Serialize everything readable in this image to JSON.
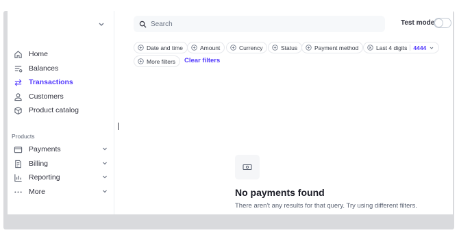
{
  "sidebar": {
    "nav": [
      {
        "label": "Home",
        "icon": "home-icon"
      },
      {
        "label": "Balances",
        "icon": "balances-icon"
      },
      {
        "label": "Transactions",
        "icon": "transactions-icon",
        "active": true
      },
      {
        "label": "Customers",
        "icon": "customer-icon"
      },
      {
        "label": "Product catalog",
        "icon": "product-icon"
      }
    ],
    "section_label": "Products",
    "products": [
      {
        "label": "Payments",
        "icon": "payments-icon"
      },
      {
        "label": "Billing",
        "icon": "billing-icon"
      },
      {
        "label": "Reporting",
        "icon": "reporting-icon"
      },
      {
        "label": "More",
        "icon": "more-icon"
      }
    ]
  },
  "header": {
    "search_placeholder": "Search",
    "test_mode_label": "Test mode",
    "test_mode_on": false
  },
  "filters": {
    "chips": [
      "Date and time",
      "Amount",
      "Currency",
      "Status",
      "Payment method"
    ],
    "last4": {
      "label": "Last 4 digits",
      "value": "4444"
    },
    "more_filters": "More filters",
    "clear": "Clear filters"
  },
  "empty_state": {
    "title": "No payments found",
    "subtitle": "There aren't any results for that query. Try using different filters."
  },
  "colors": {
    "accent": "#533afd",
    "text": "#30313d",
    "muted": "#596171"
  }
}
